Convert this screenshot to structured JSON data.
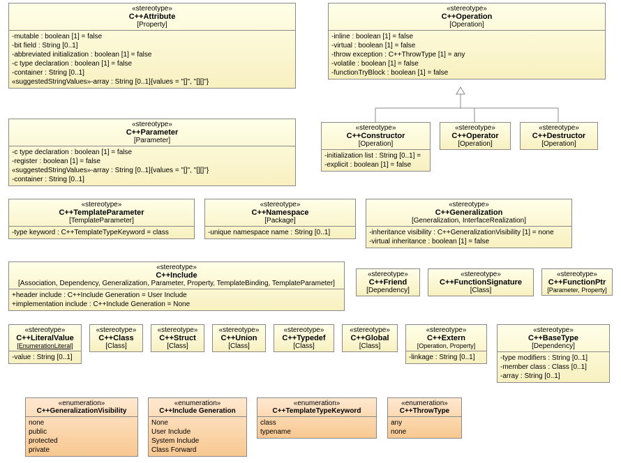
{
  "s": "«stereotype»",
  "e": "«enumeration»",
  "attr": {
    "n": "C++Attribute",
    "b": "[Property]",
    "a": [
      "-mutable : boolean [1] = false",
      "-bit field : String [0..1]",
      "-abbreviated initialization : boolean [1] = false",
      "-c type declaration : boolean [1] = false",
      "-container : String [0..1]",
      "«suggestedStringValues»-array : String [0..1]{values = \"[]\", \"[][]\"}"
    ]
  },
  "op": {
    "n": "C++Operation",
    "b": "[Operation]",
    "a": [
      "-inline : boolean [1] = false",
      "-virtual : boolean [1] = false",
      "-throw exception : C++ThrowType [1] = any",
      "-volatile : boolean [1] = false",
      "-functionTryBlock : boolean [1] = false"
    ]
  },
  "par": {
    "n": "C++Parameter",
    "b": "[Parameter]",
    "a": [
      "-c type declaration : boolean [1] = false",
      "-register : boolean [1] = false",
      "«suggestedStringValues»-array : String [0..1]{values = \"[]\", \"[][]\"}",
      "-container : String [0..1]"
    ]
  },
  "ctor": {
    "n": "C++Constructor",
    "b": "[Operation]",
    "a": [
      "-initialization list : String [0..1] =",
      "-explicit : boolean [1] = false"
    ]
  },
  "oper": {
    "n": "C++Operator",
    "b": "[Operation]"
  },
  "dtor": {
    "n": "C++Destructor",
    "b": "[Operation]"
  },
  "tpar": {
    "n": "C++TemplateParameter",
    "b": "[TemplateParameter]",
    "a": [
      "-type keyword : C++TemplateTypeKeyword = class"
    ]
  },
  "ns": {
    "n": "C++Namespace",
    "b": "[Package]",
    "a": [
      "-unique namespace name : String [0..1]"
    ]
  },
  "gen": {
    "n": "C++Generalization",
    "b": "[Generalization, InterfaceRealization]",
    "a": [
      "-inheritance visibility : C++GeneralizationVisibility [1] = none",
      "-virtual inheritance : boolean [1] = false"
    ]
  },
  "inc": {
    "n": "C++Include",
    "b": "[Association, Dependency, Generalization, Parameter, Property, TemplateBinding, TemplateParameter]",
    "a": [
      "+header include : C++Include Generation = User Include",
      "+implementation include : C++Include Generation = None"
    ]
  },
  "fr": {
    "n": "C++Friend",
    "b": "[Dependency]"
  },
  "fs": {
    "n": "C++FunctionSignature",
    "b": "[Class]"
  },
  "fp": {
    "n": "C++FunctionPtr",
    "b": "[Parameter, Property]"
  },
  "lv": {
    "n": "C++LiteralValue",
    "b": "[EnumerationLiteral]",
    "a": [
      "-value : String [0..1]"
    ]
  },
  "cls": {
    "n": "C++Class",
    "b": "[Class]"
  },
  "str": {
    "n": "C++Struct",
    "b": "[Class]"
  },
  "un": {
    "n": "C++Union",
    "b": "[Class]"
  },
  "td": {
    "n": "C++Typedef",
    "b": "[Class]"
  },
  "gl": {
    "n": "C++Global",
    "b": "[Class]"
  },
  "ext": {
    "n": "C++Extern",
    "b": "[Operation, Property]",
    "a": [
      "-linkage : String [0..1]"
    ]
  },
  "bt": {
    "n": "C++BaseType",
    "b": "[Dependency]",
    "a": [
      "-type modifiers : String [0..1]",
      "-member class : Class [0..1]",
      "-array : String [0..1]"
    ]
  },
  "egv": {
    "n": "C++GeneralizationVisibility",
    "a": [
      "none",
      "public",
      "protected",
      "private"
    ]
  },
  "eig": {
    "n": "C++Include Generation",
    "a": [
      "None",
      "User Include",
      "System Include",
      "Class Forward"
    ]
  },
  "ettk": {
    "n": "C++TemplateTypeKeyword",
    "a": [
      "class",
      "typename"
    ]
  },
  "ett": {
    "n": "C++ThrowType",
    "a": [
      "any",
      "none"
    ]
  }
}
